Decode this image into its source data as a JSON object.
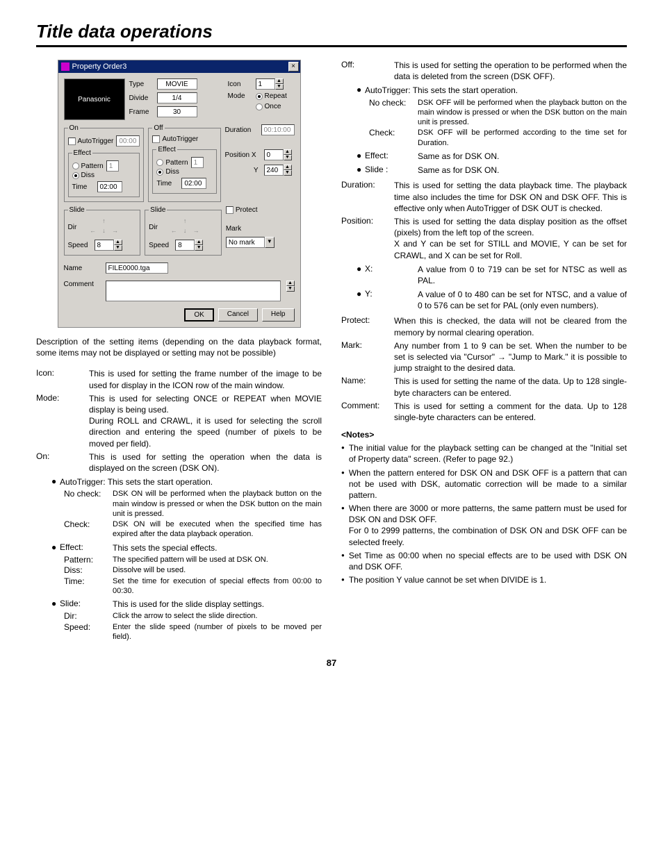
{
  "title": "Title data operations",
  "dialog": {
    "title": "Property Order3",
    "close": "×",
    "preview": "Panasonic",
    "type_lbl": "Type",
    "type_val": "MOVIE",
    "div_lbl": "Divide",
    "div_val": "1/4",
    "frame_lbl": "Frame",
    "frame_val": "30",
    "icon_lbl": "Icon",
    "icon_val": "1",
    "mode_lbl": "Mode",
    "mode_rep": "Repeat",
    "mode_once": "Once",
    "on_leg": "On",
    "off_leg": "Off",
    "auto_lbl": "AutoTrigger",
    "on_auto_val": "00:00",
    "eff_leg": "Effect",
    "pat_lbl": "Pattern",
    "pat_val": "1",
    "diss_lbl": "Diss",
    "time_lbl": "Time",
    "on_time_val": "02:00",
    "off_time_val": "02:00",
    "slide_leg": "Slide",
    "dir_lbl": "Dir",
    "speed_lbl": "Speed",
    "speed_val": "8",
    "dur_lbl": "Duration",
    "dur_val": "00:10:00",
    "posx_lbl": "Position X",
    "posx_val": "0",
    "posy_lbl": "Y",
    "posy_val": "240",
    "protect_lbl": "Protect",
    "mark_lbl": "Mark",
    "mark_val": "No mark",
    "name_lbl": "Name",
    "name_val": "FILE0000.tga",
    "comment_lbl": "Comment",
    "ok": "OK",
    "cancel": "Cancel",
    "help": "Help"
  },
  "intro": "Description of the setting items (depending on the data playback format, some items may not be displayed or setting may not be possible)",
  "left": {
    "icon_t": "Icon:",
    "icon_d": "This is used for setting the frame number of the image to be used for display in the ICON row of the main window.",
    "mode_t": "Mode:",
    "mode_d1": "This is used for selecting ONCE or REPEAT when MOVIE display is being used.",
    "mode_d2": "During ROLL and CRAWL, it is used for selecting the scroll direction and entering the speed (number of pixels to be moved per field).",
    "on_t": "On:",
    "on_d": "This is used for setting the operation when the data is displayed on the screen (DSK ON).",
    "auto_b": "AutoTrigger: This sets the start operation.",
    "noc_t": "No check:",
    "noc_d": "DSK ON will be performed when the playback button on the main window is pressed or when the DSK button on the main unit is pressed.",
    "chk_t": "Check:",
    "chk_d": "DSK ON will be executed when the specified time has expired after the data playback operation.",
    "eff_b": "Effect:",
    "eff_bd": "This sets the special effects.",
    "pat_t": "Pattern:",
    "pat_d": "The specified pattern will be used at DSK ON.",
    "dis_t": "Diss:",
    "dis_d": "Dissolve will be used.",
    "tim_t": "Time:",
    "tim_d": "Set the time for execution of special effects from 00:00 to 00:30.",
    "sli_b": "Slide:",
    "sli_bd": "This is used for the slide display settings.",
    "dir_t": "Dir:",
    "dir_d": "Click the arrow to select the slide direction.",
    "spd_t": "Speed:",
    "spd_d": "Enter the slide speed (number of pixels to be moved per field)."
  },
  "right": {
    "off_t": "Off:",
    "off_d": "This is used for setting the operation to be performed when the data is deleted from the screen (DSK OFF).",
    "auto_b": "AutoTrigger: This sets the start operation.",
    "noc_t": "No check:",
    "noc_d": "DSK OFF will be performed when the playback button on the main window is pressed or when the DSK button on the main unit is pressed.",
    "chk_t": "Check:",
    "chk_d": "DSK OFF will be performed according to the time set for Duration.",
    "eff_b": "Effect:",
    "eff_bd": "Same as for DSK ON.",
    "sli_b": "Slide :",
    "sli_bd": "Same as for DSK ON.",
    "dur_t": "Duration:",
    "dur_d": "This is used for setting the data playback time. The playback time also includes the time for DSK ON and DSK OFF.  This is effective only when AutoTrigger of DSK OUT is checked.",
    "pos_t": "Position:",
    "pos_d1": "This is used for setting the data display position as the offset (pixels) from the left top of the screen.",
    "pos_d2": "X and Y can be set for STILL and MOVIE, Y can be set for CRAWL, and X can be set for Roll.",
    "x_b": "X:",
    "x_bd": "A value from 0 to 719 can be set for NTSC as well as PAL.",
    "y_b": "Y:",
    "y_bd": "A value of 0 to 480 can be set for NTSC, and a value of 0 to 576 can be set for PAL (only even numbers).",
    "pro_t": "Protect:",
    "pro_d": "When this is checked, the data will not be cleared from the memory by normal clearing operation.",
    "mrk_t": "Mark:",
    "mrk_d": "Any number from 1 to 9 can be set.  When the number to be set is selected via \"Cursor\" → \"Jump to Mark.\"  it is possible to jump straight to the desired data.",
    "nam_t": "Name:",
    "nam_d": "This is used for setting the name of the data.  Up to 128 single-byte characters can be entered.",
    "com_t": "Comment:",
    "com_d": "This is used for setting a comment for the data. Up to 128 single-byte characters can be entered.",
    "notes_h": "<Notes>",
    "n1": "The initial value for the playback setting can be changed at the \"Initial set of Property data\" screen.  (Refer to page 92.)",
    "n2": "When the pattern entered for DSK ON and DSK OFF is a pattern that can not be used with DSK, automatic correction will be made to a similar pattern.",
    "n3a": "When there are 3000 or more patterns, the same pattern must be used for DSK ON and DSK OFF.",
    "n3b": "For 0 to 2999 patterns, the combination of DSK ON and DSK OFF can be selected freely.",
    "n4": "Set Time as 00:00 when no special effects are to be used with DSK ON and DSK OFF.",
    "n5": "The position Y value cannot be set when DIVIDE is 1."
  },
  "pnum": "87"
}
